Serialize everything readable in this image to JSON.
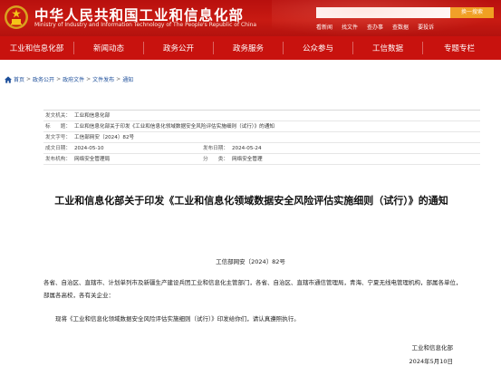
{
  "header": {
    "title": "中华人民共和国工业和信息化部",
    "subtitle": "Ministry of Industry and Information Technology of The People's Republic of China",
    "search_button": "换一搜索",
    "quick_links": [
      "看新闻",
      "找文件",
      "查办事",
      "查数据",
      "要投诉"
    ]
  },
  "nav": {
    "items": [
      "工业和信息化部",
      "新闻动态",
      "政务公开",
      "政务服务",
      "公众参与",
      "工信数据",
      "专题专栏"
    ]
  },
  "breadcrumb": {
    "items": [
      "首页",
      "政务公开",
      "政府文件",
      "文件发布",
      "通知"
    ],
    "separator": ">"
  },
  "meta": {
    "issuer_label": "发文机关：",
    "issuer": "工业和信息化部",
    "title_label": "标　　题：",
    "title": "工业和信息化部关于印发《工业和信息化领域数据安全风险评估实施细则（试行）》的通知",
    "docno_label": "发文字号：",
    "docno": "工信部网安〔2024〕82号",
    "written_label": "成文日期：",
    "written": "2024-05-10",
    "published_label": "发布日期：",
    "published": "2024-05-24",
    "agency_label": "发布机构：",
    "agency": "网络安全管理局",
    "category_label": "分　　类：",
    "category": "网络安全管理"
  },
  "document": {
    "title": "工业和信息化部关于印发《工业和信息化领域数据安全风险评估实施细则（试行）》的通知",
    "docno": "工信部网安〔2024〕82号",
    "recipients": "各省、自治区、直辖市、计划单列市及新疆生产建设兵团工业和信息化主管部门，各省、自治区、直辖市通信管理局，青海、宁夏无线电管理机构，部属各单位，部属各高校，各有关企业：",
    "body": "现将《工业和信息化领域数据安全风险评估实施细则（试行）》印发给你们，请认真遵照执行。",
    "signature": "工业和信息化部",
    "date": "2024年5月10日"
  },
  "colors": {
    "header_red": "#c8120e",
    "link_blue": "#1c4e9a",
    "search_orange": "#f0a020"
  }
}
